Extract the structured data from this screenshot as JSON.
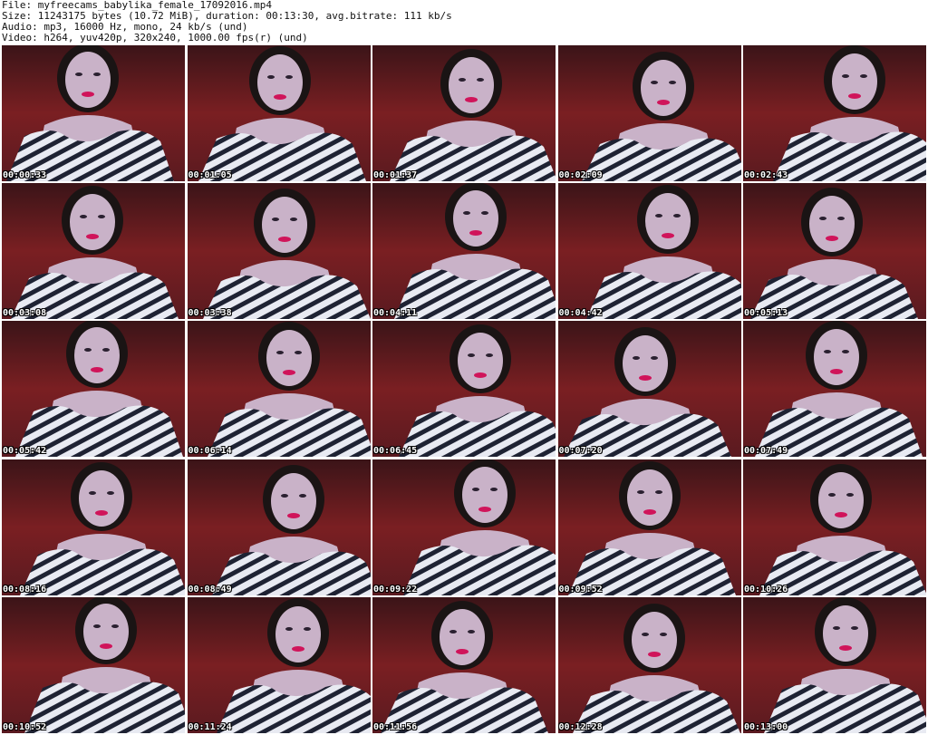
{
  "header": {
    "file": "File: myfreecams_babylika_female_17092016.mp4",
    "size": "Size: 11243175 bytes (10.72 MiB), duration: 00:13:30, avg.bitrate: 111 kb/s",
    "audio": "Audio: mp3, 16000 Hz, mono, 24 kb/s (und)",
    "video": "Video: h264, yuv420p, 320x240, 1000.00 fps(r) (und)"
  },
  "frames": [
    "00:00:33",
    "00:01:05",
    "00:01:37",
    "00:02:09",
    "00:02:43",
    "00:03:08",
    "00:03:38",
    "00:04:11",
    "00:04:42",
    "00:05:13",
    "00:05:42",
    "00:06:14",
    "00:06:45",
    "00:07:20",
    "00:07:49",
    "00:08:16",
    "00:08:49",
    "00:09:22",
    "00:09:52",
    "00:10:26",
    "00:10:52",
    "00:11:24",
    "00:11:56",
    "00:12:28",
    "00:13:00"
  ],
  "colors": {
    "background_wall": "#7a1f22",
    "stripe_dark": "#1e2233",
    "stripe_light": "#e8eaf2",
    "skin": "#c9b2c8",
    "hair": "#1a1414"
  }
}
